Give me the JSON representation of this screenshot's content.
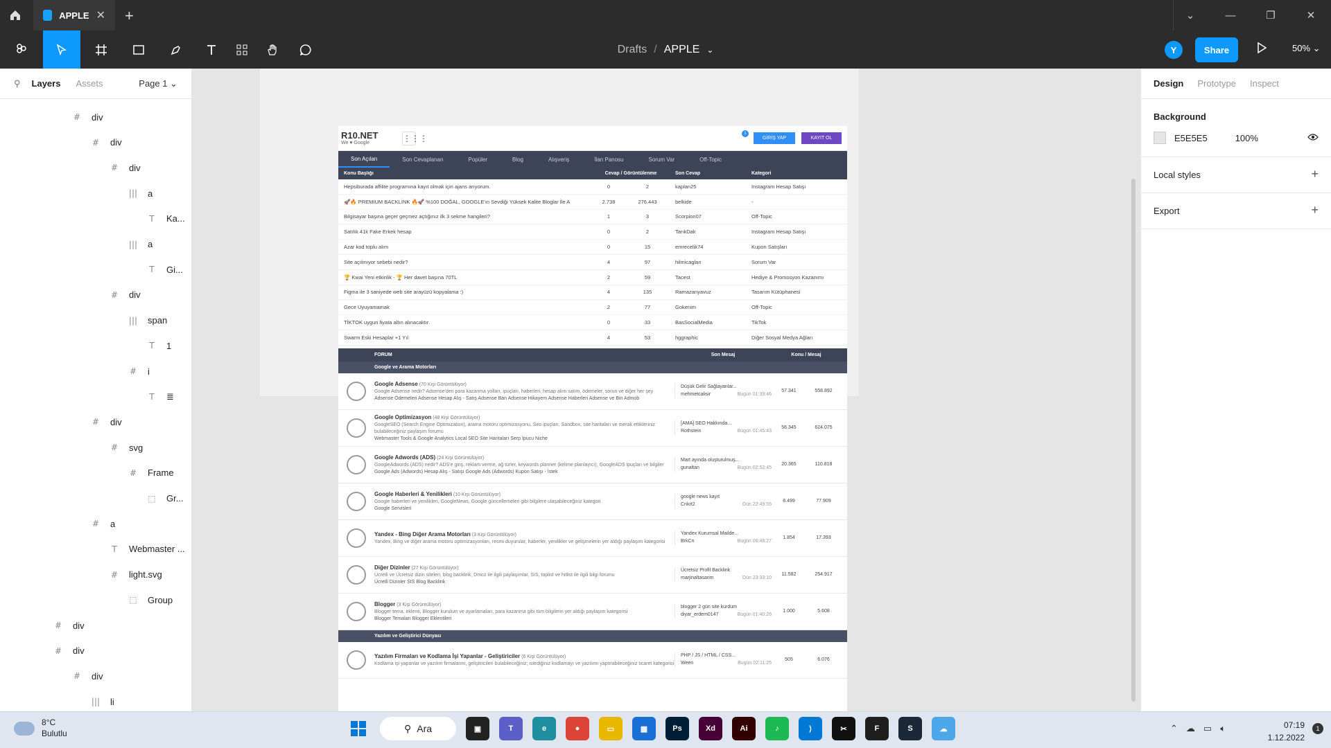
{
  "titlebar": {
    "tab_title": "APPLE"
  },
  "toolbar": {
    "breadcrumb_root": "Drafts",
    "breadcrumb_sep": "/",
    "file_name": "APPLE",
    "avatar_initial": "Y",
    "share_label": "Share",
    "zoom": "50%"
  },
  "left_panel": {
    "tabs": [
      "Layers",
      "Assets"
    ],
    "page": "Page 1",
    "layers": [
      {
        "icon": "#",
        "label": "div",
        "indent": 1
      },
      {
        "icon": "#",
        "label": "div",
        "indent": 2
      },
      {
        "icon": "#",
        "label": "div",
        "indent": 3
      },
      {
        "icon": "|||",
        "label": "a",
        "indent": 4
      },
      {
        "icon": "T",
        "label": "Ka...",
        "indent": 5
      },
      {
        "icon": "|||",
        "label": "a",
        "indent": 4
      },
      {
        "icon": "T",
        "label": "Gi...",
        "indent": 5
      },
      {
        "icon": "#",
        "label": "div",
        "indent": 3
      },
      {
        "icon": "|||",
        "label": "span",
        "indent": 4
      },
      {
        "icon": "T",
        "label": "1",
        "indent": 5
      },
      {
        "icon": "#",
        "label": "i",
        "indent": 4
      },
      {
        "icon": "T",
        "label": "≣",
        "indent": 5
      },
      {
        "icon": "#",
        "label": "div",
        "indent": 2
      },
      {
        "icon": "#",
        "label": "svg",
        "indent": 3
      },
      {
        "icon": "#",
        "label": "Frame",
        "indent": 4
      },
      {
        "icon": "⬚",
        "label": "Gr...",
        "indent": 5
      },
      {
        "icon": "#",
        "label": "a",
        "indent": 2
      },
      {
        "icon": "T",
        "label": "Webmaster ...",
        "indent": 3
      },
      {
        "icon": "#",
        "label": "light.svg",
        "indent": 3
      },
      {
        "icon": "⬚",
        "label": "Group",
        "indent": 4
      },
      {
        "icon": "#",
        "label": "div",
        "indent": 0
      },
      {
        "icon": "#",
        "label": "div",
        "indent": 0
      },
      {
        "icon": "#",
        "label": "div",
        "indent": 1
      },
      {
        "icon": "|||",
        "label": "li",
        "indent": 2
      }
    ]
  },
  "site": {
    "logo": "R10.NET",
    "logo_sub": "We ♥ Google",
    "notif_count": "1",
    "login": "GİRİŞ YAP",
    "register": "KAYIT OL",
    "nav": [
      "Son Açılan",
      "Son Cevaplanan",
      "Popüler",
      "Blog",
      "Alışveriş",
      "İlan Panosu",
      "Sorum Var",
      "Off-Topic"
    ],
    "table_headers": [
      "Konu Başlığı",
      "Cevap / Görüntülenme",
      "Son Cevap",
      "Kategori"
    ],
    "topics": [
      {
        "title": "Hepsiburada affilite programına kayıt olmak için ajans arıyorum.",
        "replies": "0",
        "views": "2",
        "last": "kaplan25",
        "cat": "Instagram Hesap Satışı"
      },
      {
        "title": "🚀🔥 PREMIUM BACKLİNK 🔥🚀 %100 DOĞAL, GOOGLE'ın Sevdiği Yüksek Kalite Bloglar İle A",
        "replies": "2.738",
        "views": "276.443",
        "last": "belkide",
        "cat": "-"
      },
      {
        "title": "Bilgisayar başına geçer geçmez açtığınız ilk 3 sekme hangileri?",
        "replies": "1",
        "views": "3",
        "last": "Scorpion07",
        "cat": "Off-Topic"
      },
      {
        "title": "Satılık 41k Fake Erkek hesap",
        "replies": "0",
        "views": "2",
        "last": "TarıkDak",
        "cat": "Instagram Hesap Satışı"
      },
      {
        "title": "Azar kod toplu alım",
        "replies": "0",
        "views": "15",
        "last": "emrecelik74",
        "cat": "Kupon Satışları"
      },
      {
        "title": "Site açılmıyor sebebi nedir?",
        "replies": "4",
        "views": "97",
        "last": "hilmicaglan",
        "cat": "Sorum Var"
      },
      {
        "title": "🏆 Kwai Yeni etkinlik - 🏆 Her davet başına 70TL",
        "replies": "2",
        "views": "59",
        "last": "Tacest",
        "cat": "Hediye & Promosyon Kazanımı"
      },
      {
        "title": "Figma ile 3 saniyede web site arayüzü kopyalama :)",
        "replies": "4",
        "views": "135",
        "last": "Ramazanyavuz",
        "cat": "Tasarım Kütüphanesi"
      },
      {
        "title": "Gece Uyuyamamak",
        "replies": "2",
        "views": "77",
        "last": "Gokenim",
        "cat": "Off-Topic"
      },
      {
        "title": "TİKTOK uygun fiyata altın alınacaktır.",
        "replies": "0",
        "views": "33",
        "last": "BasSocialMedia",
        "cat": "TikTok"
      },
      {
        "title": "Swarm Eski Hesaplar +1 Yıl",
        "replies": "4",
        "views": "53",
        "last": "hggraphic",
        "cat": "Diğer Sosyal Medya Ağları"
      }
    ],
    "forum_headers": [
      "FORUM",
      "Son Mesaj",
      "Konu / Mesaj"
    ],
    "cat1": "Google ve Arama Motorları",
    "cat2": "Yazılım ve Geliştirici Dünyası",
    "forums": [
      {
        "name": "Google Adsense",
        "viewers": "(70 Kişi Görüntülüyor)",
        "desc": "Google Adsense nedir? Adsense'den para kazanma yolları, ipuçları, haberleri, hesap alım satım, ödemeler, sorun ve diğer her şey",
        "subs": "Adsense Ödemeleri   Adsense Hesap Alış - Satış   Adsense Ban   Adsense Hikayem   Adsense Haberleri   Adsense ve Bin   Admob",
        "last_title": "Düşük Gelir Sağlayanlar...",
        "last_user": "mehmetcalisir",
        "last_time": "Bugün 01:39:46",
        "topics": "57.341",
        "msgs": "558.892"
      },
      {
        "name": "Google Optimizasyon",
        "viewers": "(48 Kişi Görüntülüyor)",
        "desc": "GoogleSEO (Search Engine Optimization), arama motoru optimizasyonu, Seo ipuçları, Sandbox, site haritaları ve merak ettikleriniz bulabileceğiniz paylaşım forumu",
        "subs": "Webmaster Tools & Google Analytics   Local SEO   Site Haritaları   Serp İpucu   Niche",
        "last_title": "[AMA] SEO Hakkında...",
        "last_user": "Rothstein",
        "last_time": "Bugün 01:45:43",
        "topics": "56.345",
        "msgs": "624.075"
      },
      {
        "name": "Google Adwords (ADS)",
        "viewers": "(24 Kişi Görüntülüyor)",
        "desc": "GoogleAdwords (ADS) nedir? ADS'e giriş, reklam verme, ağ türler, keywords planner (kelime planlayıcı), GoogleADS ipuçları ve bilgiler",
        "subs": "Google Ads (Adwords) Hesap Alış - Satışı   Google Ads (Adwords) Kupon Satışı - İstek",
        "last_title": "Mart ayında oluşturulmuş...",
        "last_user": "gunaltan",
        "last_time": "Bugün 02:52:45",
        "topics": "20.365",
        "msgs": "110.818"
      },
      {
        "name": "Google Haberleri & Yenilikleri",
        "viewers": "(10 Kişi Görüntülüyor)",
        "desc": "Google haberleri ve yenilikleri, GoogleNews, Google güncellemeleri gibi bilgilere ulaşabileceğiniz kategori",
        "subs": "Google Servisleri",
        "last_title": "google news kayıt",
        "last_user": "Cnkrt2",
        "last_time": "Dün 22:49:55",
        "topics": "8.499",
        "msgs": "77.909"
      },
      {
        "name": "Yandex - Bing Diğer Arama Motorları",
        "viewers": "(3 Kişi Görüntülüyor)",
        "desc": "Yandex, Bing ve diğer arama motoru optimizasyonları, resmi duyurular, haberler, yenilikler ve gelişmelerin yer aldığı paylaşım kategorisi",
        "subs": "",
        "last_title": "Yandex Kurumsal Mailde...",
        "last_user": "BrkCn",
        "last_time": "Bugün 06:48:27",
        "topics": "1.854",
        "msgs": "17.393"
      },
      {
        "name": "Diğer Dizinler",
        "viewers": "(27 Kişi Görüntülüyor)",
        "desc": "Ücretli ve Ücretsiz dizin siteleri, blog backlink, Dmoz ile ilgili paylaşımlar, SIS, toplist ve hitlist ile ilgili bilgi forumu",
        "subs": "Ücretli Dizinler   SIS   Blog Backlink",
        "last_title": "Ücretsiz Profil Backlink",
        "last_user": "marjinaltasarim",
        "last_time": "Dün 23:33:10",
        "topics": "11.582",
        "msgs": "254.917"
      },
      {
        "name": "Blogger",
        "viewers": "(3 Kişi Görüntülüyor)",
        "desc": "Blogger tema, eklenti, Blogger kurulum ve ayarlamaları, para kazanma gibi tüm bilgilerin yer aldığı paylaşım kategorisi",
        "subs": "Blogger Temaları   Blogger Eklentileri",
        "last_title": "blogger 2 gün site kurdum",
        "last_user": "diyar_erdem0147",
        "last_time": "Bugün 01:40:26",
        "topics": "1.000",
        "msgs": "5.608"
      },
      {
        "name": "Yazılım Firmaları ve Kodlama İşi Yapanlar - Geliştiriciler",
        "viewers": "(6 Kişi Görüntülüyor)",
        "desc": "Kodlama işi yapanlar ve yazılım firmalarını, geliştiricileri bulabileceğiniz; istediğiniz kodlamayı ve yazılımı yaptırabileceğiniz ticaret kategorisi",
        "subs": "",
        "last_title": "PHP / JS / HTML / CSS...",
        "last_user": "Ween",
        "last_time": "Bugün 02:11:25",
        "topics": "505",
        "msgs": "6.076"
      }
    ]
  },
  "right_panel": {
    "tabs": [
      "Design",
      "Prototype",
      "Inspect"
    ],
    "background_title": "Background",
    "bg_hex": "E5E5E5",
    "bg_opacity": "100%",
    "local_styles": "Local styles",
    "export": "Export"
  },
  "help_label": "?",
  "taskbar": {
    "temp": "8°C",
    "weather": "Bulutlu",
    "search": "Ara",
    "time": "07:19",
    "date": "1.12.2022",
    "apps": [
      {
        "name": "task-view",
        "label": "▣",
        "color": "#222"
      },
      {
        "name": "teams",
        "label": "T",
        "color": "#5b5fc7"
      },
      {
        "name": "edge",
        "label": "e",
        "color": "#1f8f9f"
      },
      {
        "name": "chrome",
        "label": "●",
        "color": "#db4437"
      },
      {
        "name": "explorer",
        "label": "▭",
        "color": "#e8b800"
      },
      {
        "name": "store",
        "label": "▦",
        "color": "#1a6fd6"
      },
      {
        "name": "photoshop",
        "label": "Ps",
        "color": "#001e36"
      },
      {
        "name": "xd",
        "label": "Xd",
        "color": "#470137"
      },
      {
        "name": "illustrator",
        "label": "Ai",
        "color": "#330000"
      },
      {
        "name": "spotify",
        "label": "♪",
        "color": "#1db954"
      },
      {
        "name": "vscode",
        "label": "⟩",
        "color": "#0078d4"
      },
      {
        "name": "capcut",
        "label": "✂",
        "color": "#111"
      },
      {
        "name": "figma",
        "label": "F",
        "color": "#1e1e1e"
      },
      {
        "name": "steam",
        "label": "S",
        "color": "#1b2838"
      },
      {
        "name": "weather-app",
        "label": "☁",
        "color": "#4ea7e8"
      }
    ]
  }
}
